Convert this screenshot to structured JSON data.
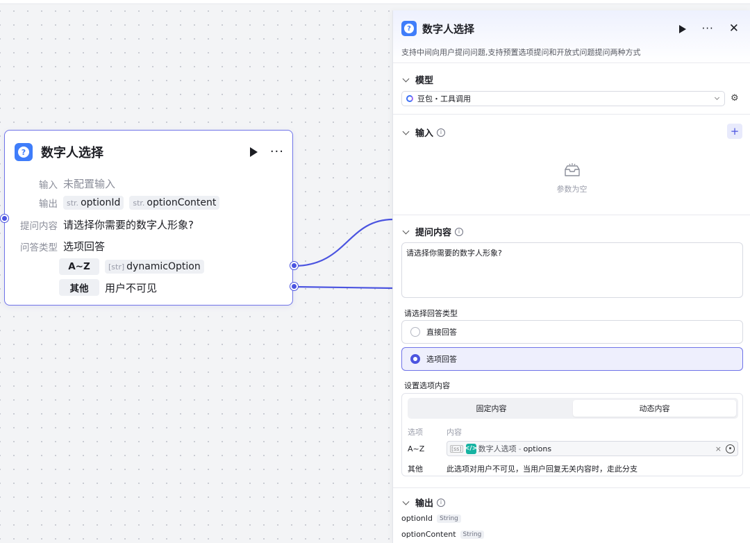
{
  "node": {
    "title": "数字人选择",
    "rows": {
      "input_label": "输入",
      "input_value": "未配置输入",
      "output_label": "输出",
      "outputs": [
        {
          "type": "str.",
          "name": "optionId"
        },
        {
          "type": "str.",
          "name": "optionContent"
        }
      ],
      "question_label": "提问内容",
      "question_value": "请选择你需要的数字人形象?",
      "answer_type_label": "问答类型",
      "answer_type_value": "选项回答"
    },
    "options": [
      {
        "key": "A~Z",
        "type": "[str]",
        "value": "dynamicOption"
      },
      {
        "key": "其他",
        "value": "用户不可见"
      }
    ]
  },
  "panel": {
    "title": "数字人选择",
    "description": "支持中间向用户提问问题,支持预置选项提问和开放式问题提问两种方式",
    "sections": {
      "model": "模型",
      "input": "输入",
      "prompt": "提问内容",
      "output": "输出"
    },
    "model_value": "豆包・工具调用",
    "input_empty": "参数为空",
    "add_symbol": "+",
    "prompt_text": "请选择你需要的数字人形象?",
    "answer_type_label": "请选择回答类型",
    "answer_types": [
      {
        "label": "直接回答",
        "selected": false
      },
      {
        "label": "选项回答",
        "selected": true
      }
    ],
    "option_setting_label": "设置选项内容",
    "option_tabs": [
      {
        "label": "固定内容",
        "active": false
      },
      {
        "label": "动态内容",
        "active": true
      }
    ],
    "option_table": {
      "headers": [
        "选项",
        "内容"
      ],
      "az_key": "A~Z",
      "az_array_tag": "[ss]",
      "az_code_icon": "</>",
      "az_source": "数字人选项",
      "az_sep": "-",
      "az_var": "options",
      "clear_symbol": "×",
      "other_key": "其他",
      "other_desc": "此选项对用户不可见，当用户回复无关内容时，走此分支"
    },
    "outputs": [
      {
        "name": "optionId",
        "type": "String"
      },
      {
        "name": "optionContent",
        "type": "String"
      }
    ]
  },
  "colors": {
    "accent": "#4b54e0",
    "node_border": "#6f73e8",
    "icon_blue": "#3f7dfa"
  }
}
